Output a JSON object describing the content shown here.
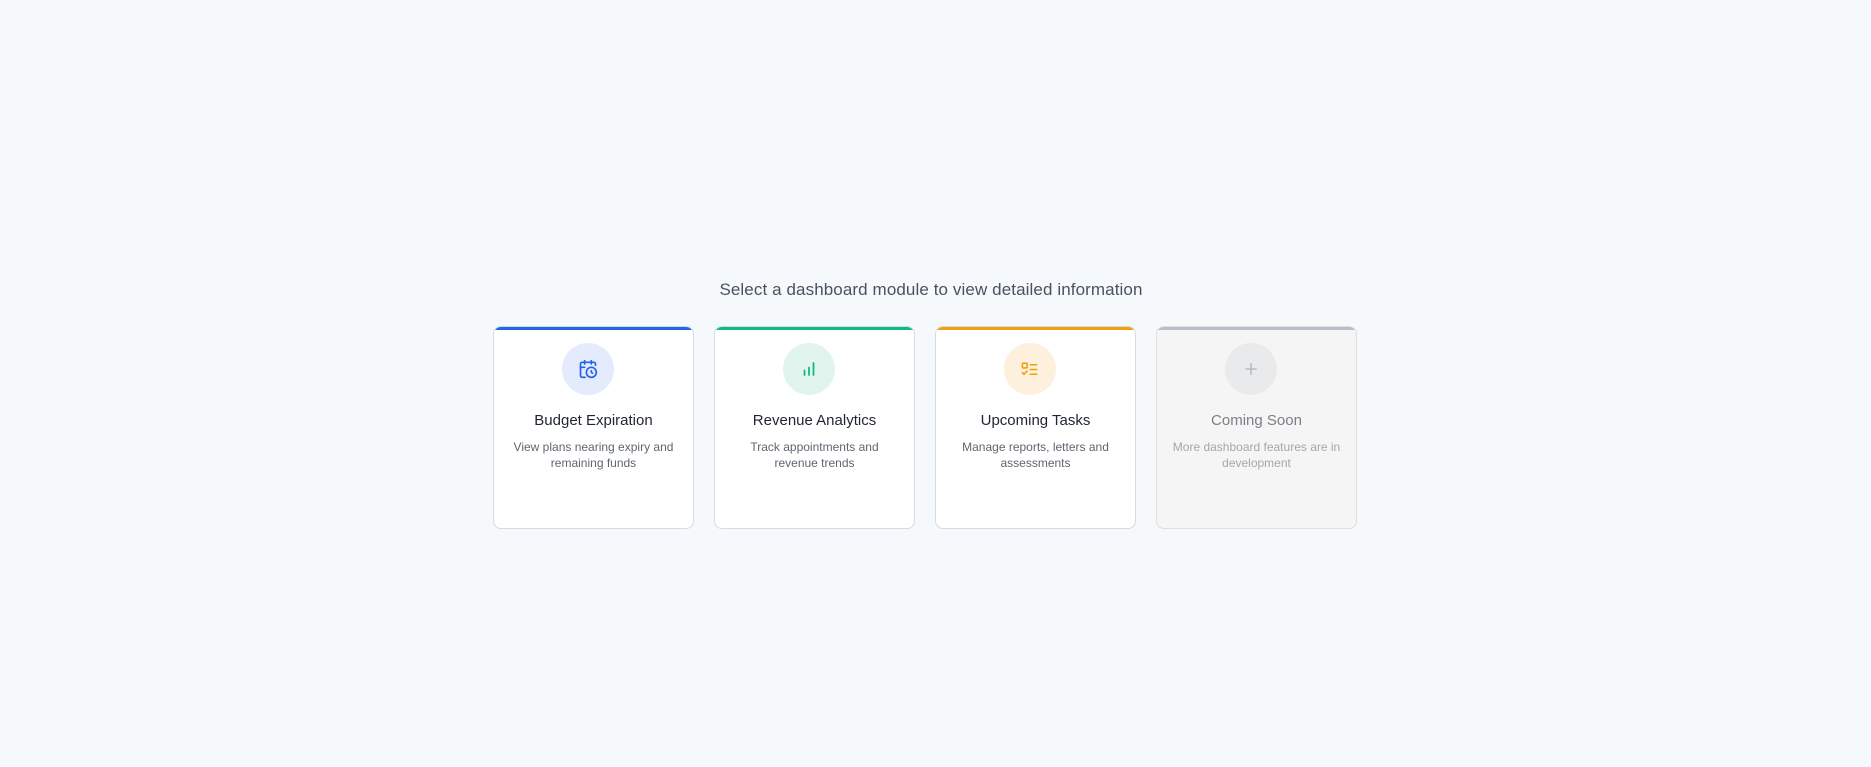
{
  "subtitle": "Select a dashboard module to view detailed information",
  "cards": [
    {
      "title": "Budget Expiration",
      "description": "View plans nearing expiry and remaining funds",
      "icon": "calendar-clock-icon",
      "accent": "#2563eb",
      "icon_bg": "#e3ebfc"
    },
    {
      "title": "Revenue Analytics",
      "description": "Track appointments and revenue trends",
      "icon": "bar-chart-icon",
      "accent": "#10b981",
      "icon_bg": "#e1f5ee"
    },
    {
      "title": "Upcoming Tasks",
      "description": "Manage reports, letters and assessments",
      "icon": "task-list-icon",
      "accent": "#f59e0b",
      "icon_bg": "#fdf0dc"
    },
    {
      "title": "Coming Soon",
      "description": "More dashboard features are in development",
      "icon": "plus-icon",
      "accent": "#b8bec6",
      "icon_bg": "#e9eaec"
    }
  ]
}
